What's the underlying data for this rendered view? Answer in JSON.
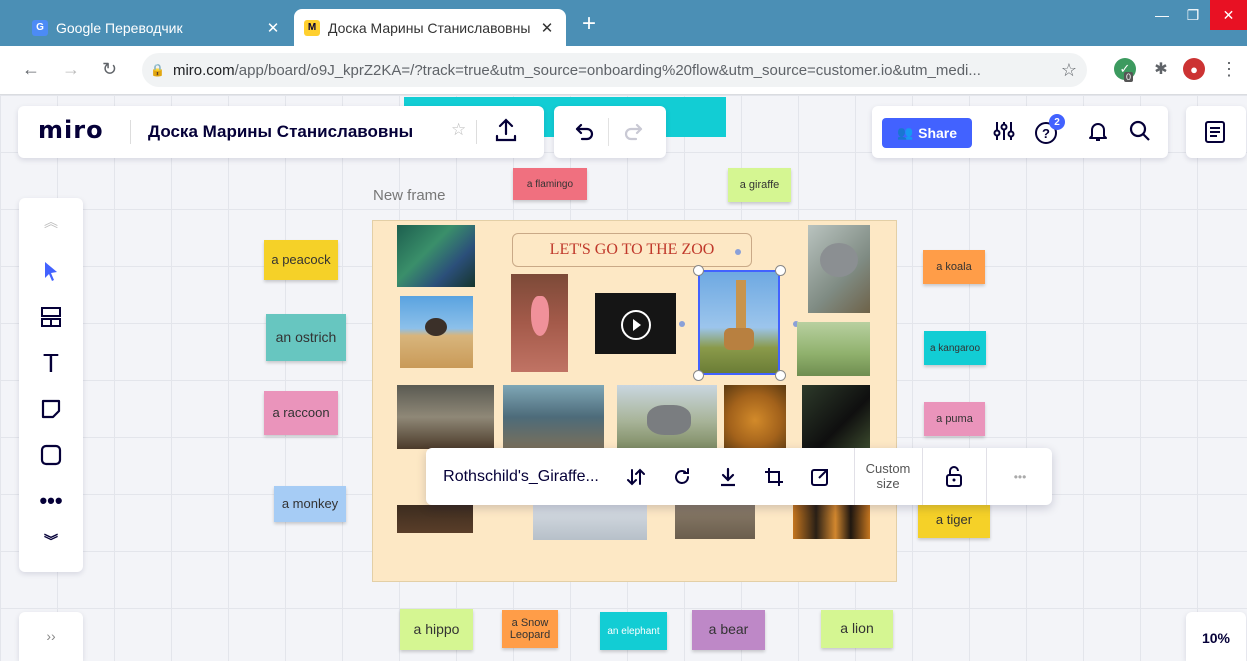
{
  "browser": {
    "tabs": [
      {
        "title": "Google Переводчик",
        "favicon": "google-translate-icon",
        "active": false
      },
      {
        "title": "Доска Марины Станиславовны",
        "favicon": "miro-icon",
        "active": true
      }
    ],
    "new_tab": "+",
    "url_host": "miro.com",
    "url_rest": "/app/board/o9J_kprZ2KA=/?track=true&utm_source=onboarding%20flow&utm_source=customer.io&utm_medi...",
    "ext_badge": "0",
    "colors": {
      "tabbar": "#4b8fb5",
      "close": "#e81123"
    }
  },
  "toolbar": {
    "logo": "miro",
    "board_name": "Доска Марины Станиславовны",
    "share_label": "Share",
    "help_badge": "2",
    "zoom": "10%",
    "accent": "#4262ff"
  },
  "left_tools": [
    "collapse-up-icon",
    "select-icon",
    "templates-icon",
    "text-icon",
    "sticky-note-icon",
    "shape-icon",
    "more-icon",
    "collapse-down-icon"
  ],
  "frame": {
    "label": "New frame",
    "title": "LET'S GO TO THE ZOO",
    "fill": "#fde8c5"
  },
  "stickies": [
    {
      "id": "flamingo",
      "text": "a flamingo",
      "color": "#f0707f"
    },
    {
      "id": "giraffe",
      "text": "a giraffe",
      "color": "#d5f692"
    },
    {
      "id": "peacock",
      "text": "a peacock",
      "color": "#f5d128"
    },
    {
      "id": "ostrich",
      "text": "an ostrich",
      "color": "#67c6c0"
    },
    {
      "id": "raccoon",
      "text": "a raccoon",
      "color": "#ea94bb"
    },
    {
      "id": "monkey",
      "text": "a monkey",
      "color": "#a6ccf5"
    },
    {
      "id": "koala",
      "text": "a koala",
      "color": "#ff9d48"
    },
    {
      "id": "kangaroo",
      "text": "a kangaroo",
      "color": "#12cdd4"
    },
    {
      "id": "puma",
      "text": "a puma",
      "color": "#ea94bb"
    },
    {
      "id": "tiger",
      "text": "a tiger",
      "color": "#f5d128"
    },
    {
      "id": "hippo",
      "text": "a hippo",
      "color": "#d5f692"
    },
    {
      "id": "snow-leopard",
      "text": "a Snow Leopard",
      "color": "#ff9d48"
    },
    {
      "id": "elephant",
      "text": "an elephant",
      "color": "#12cdd4"
    },
    {
      "id": "bear",
      "text": "a bear",
      "color": "#be88c7"
    },
    {
      "id": "lion",
      "text": "a lion",
      "color": "#d5f692"
    }
  ],
  "context_menu": {
    "file_name": "Rothschild's_Giraffe...",
    "size_label": "Custom size",
    "more": "•••"
  }
}
